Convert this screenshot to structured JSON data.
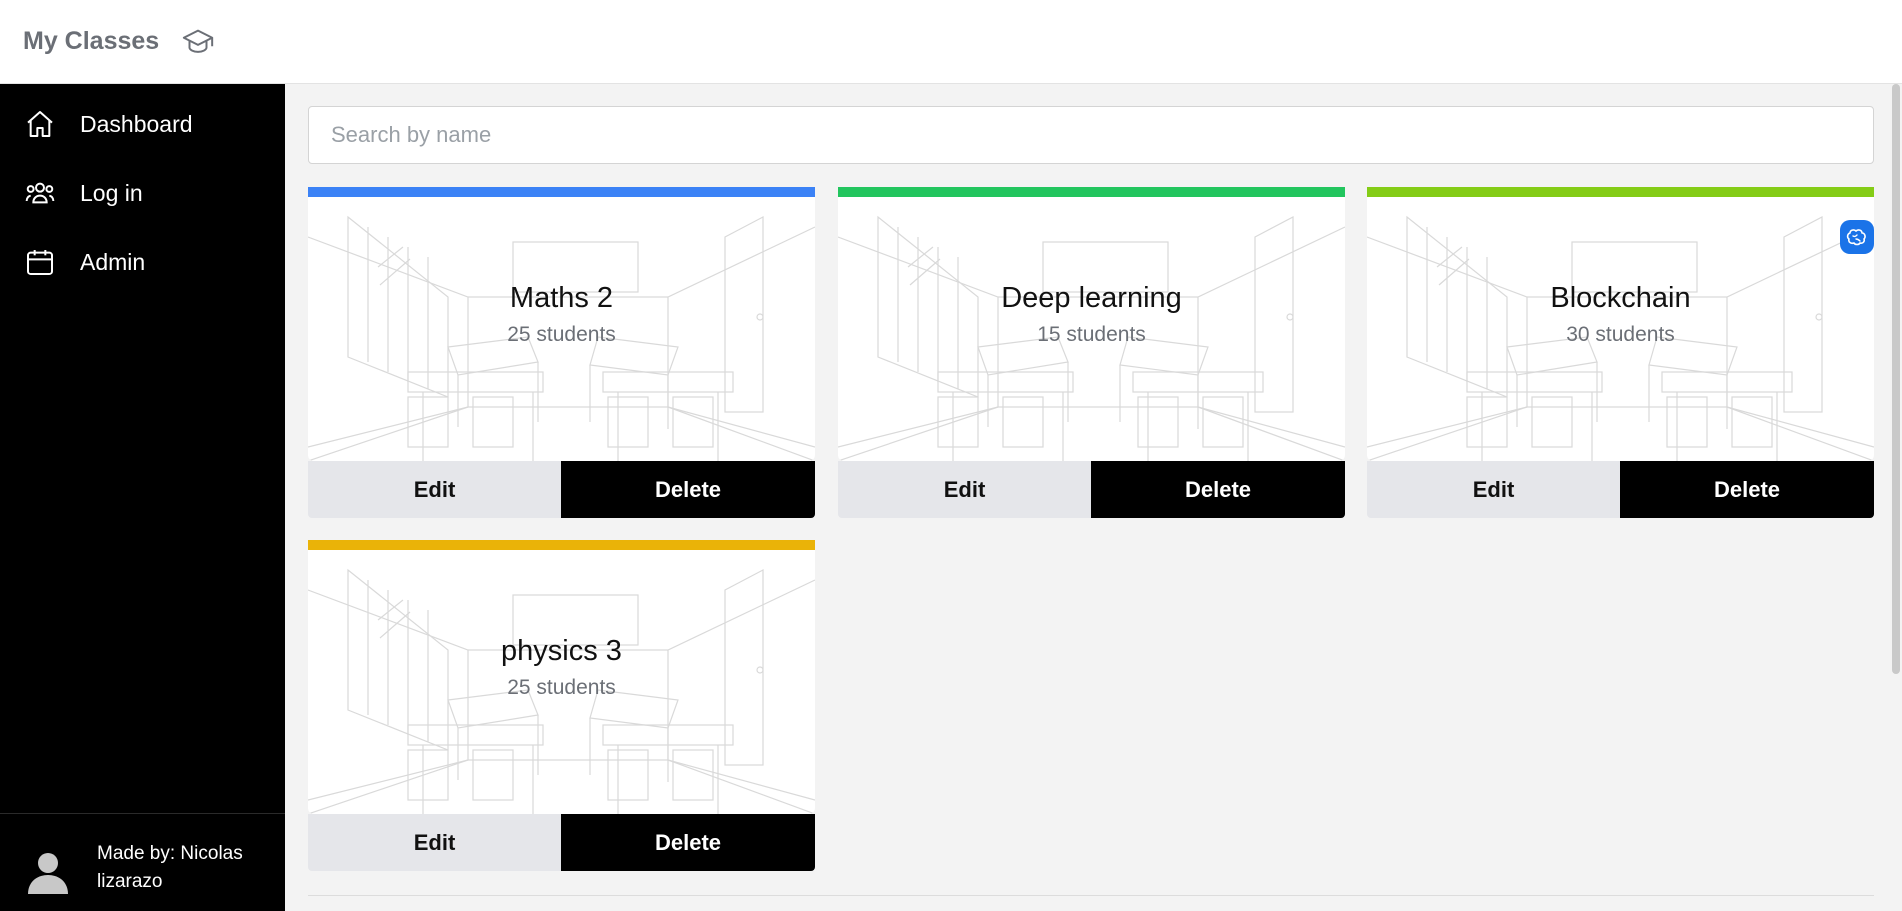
{
  "header": {
    "title": "My Classes",
    "icon": "graduation-cap-icon"
  },
  "sidebar": {
    "items": [
      {
        "label": "Dashboard",
        "icon": "home-icon"
      },
      {
        "label": "Log in",
        "icon": "users-icon"
      },
      {
        "label": "Admin",
        "icon": "calendar-icon"
      }
    ],
    "footer": {
      "credit": "Made by: Nicolas lizarazo",
      "icon": "user-avatar-icon"
    }
  },
  "search": {
    "placeholder": "Search by name",
    "value": ""
  },
  "classes": [
    {
      "name": "Maths 2",
      "students": "25 students",
      "color": "#3b82f6",
      "edit_label": "Edit",
      "delete_label": "Delete"
    },
    {
      "name": "Deep learning",
      "students": "15 students",
      "color": "#22c55e",
      "edit_label": "Edit",
      "delete_label": "Delete"
    },
    {
      "name": "Blockchain",
      "students": "30 students",
      "color": "#84cc16",
      "edit_label": "Edit",
      "delete_label": "Delete"
    },
    {
      "name": "physics 3",
      "students": "25 students",
      "color": "#eab308",
      "edit_label": "Edit",
      "delete_label": "Delete"
    }
  ]
}
